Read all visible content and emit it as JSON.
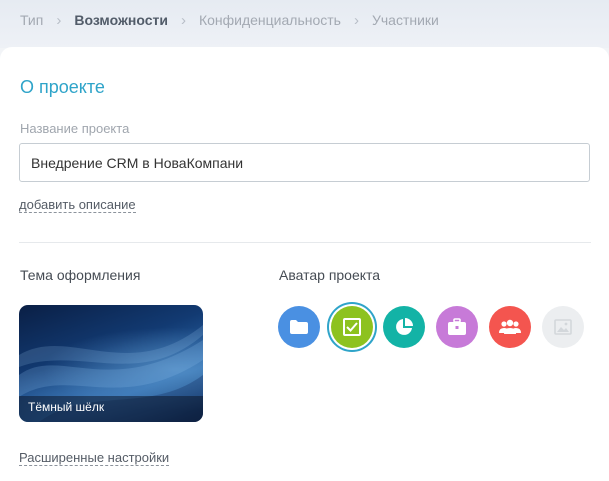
{
  "breadcrumb": {
    "items": [
      {
        "label": "Тип",
        "active": false
      },
      {
        "label": "Возможности",
        "active": true
      },
      {
        "label": "Конфиденциальность",
        "active": false
      },
      {
        "label": "Участники",
        "active": false
      }
    ],
    "separator": "›"
  },
  "project": {
    "section_title": "О проекте",
    "name_label": "Название проекта",
    "name_value": "Внедрение CRM в НоваКомпани",
    "add_description": "добавить описание"
  },
  "theme": {
    "label": "Тема оформления",
    "selected_name": "Тёмный шёлк"
  },
  "avatar": {
    "label": "Аватар проекта",
    "options": [
      {
        "icon": "folder-icon",
        "color": "#4a90e2",
        "selected": false
      },
      {
        "icon": "checklist-icon",
        "color": "#8dc21f",
        "selected": true
      },
      {
        "icon": "pie-chart-icon",
        "color": "#13b3a6",
        "selected": false
      },
      {
        "icon": "briefcase-icon",
        "color": "#c77ad8",
        "selected": false
      },
      {
        "icon": "group-icon",
        "color": "#f4554f",
        "selected": false
      },
      {
        "icon": "image-icon",
        "color": "#eceef0",
        "selected": false
      }
    ]
  },
  "advanced_settings": "Расширенные настройки",
  "colors": {
    "accent": "#2fa4c9",
    "text_muted": "#a0a6ae"
  }
}
